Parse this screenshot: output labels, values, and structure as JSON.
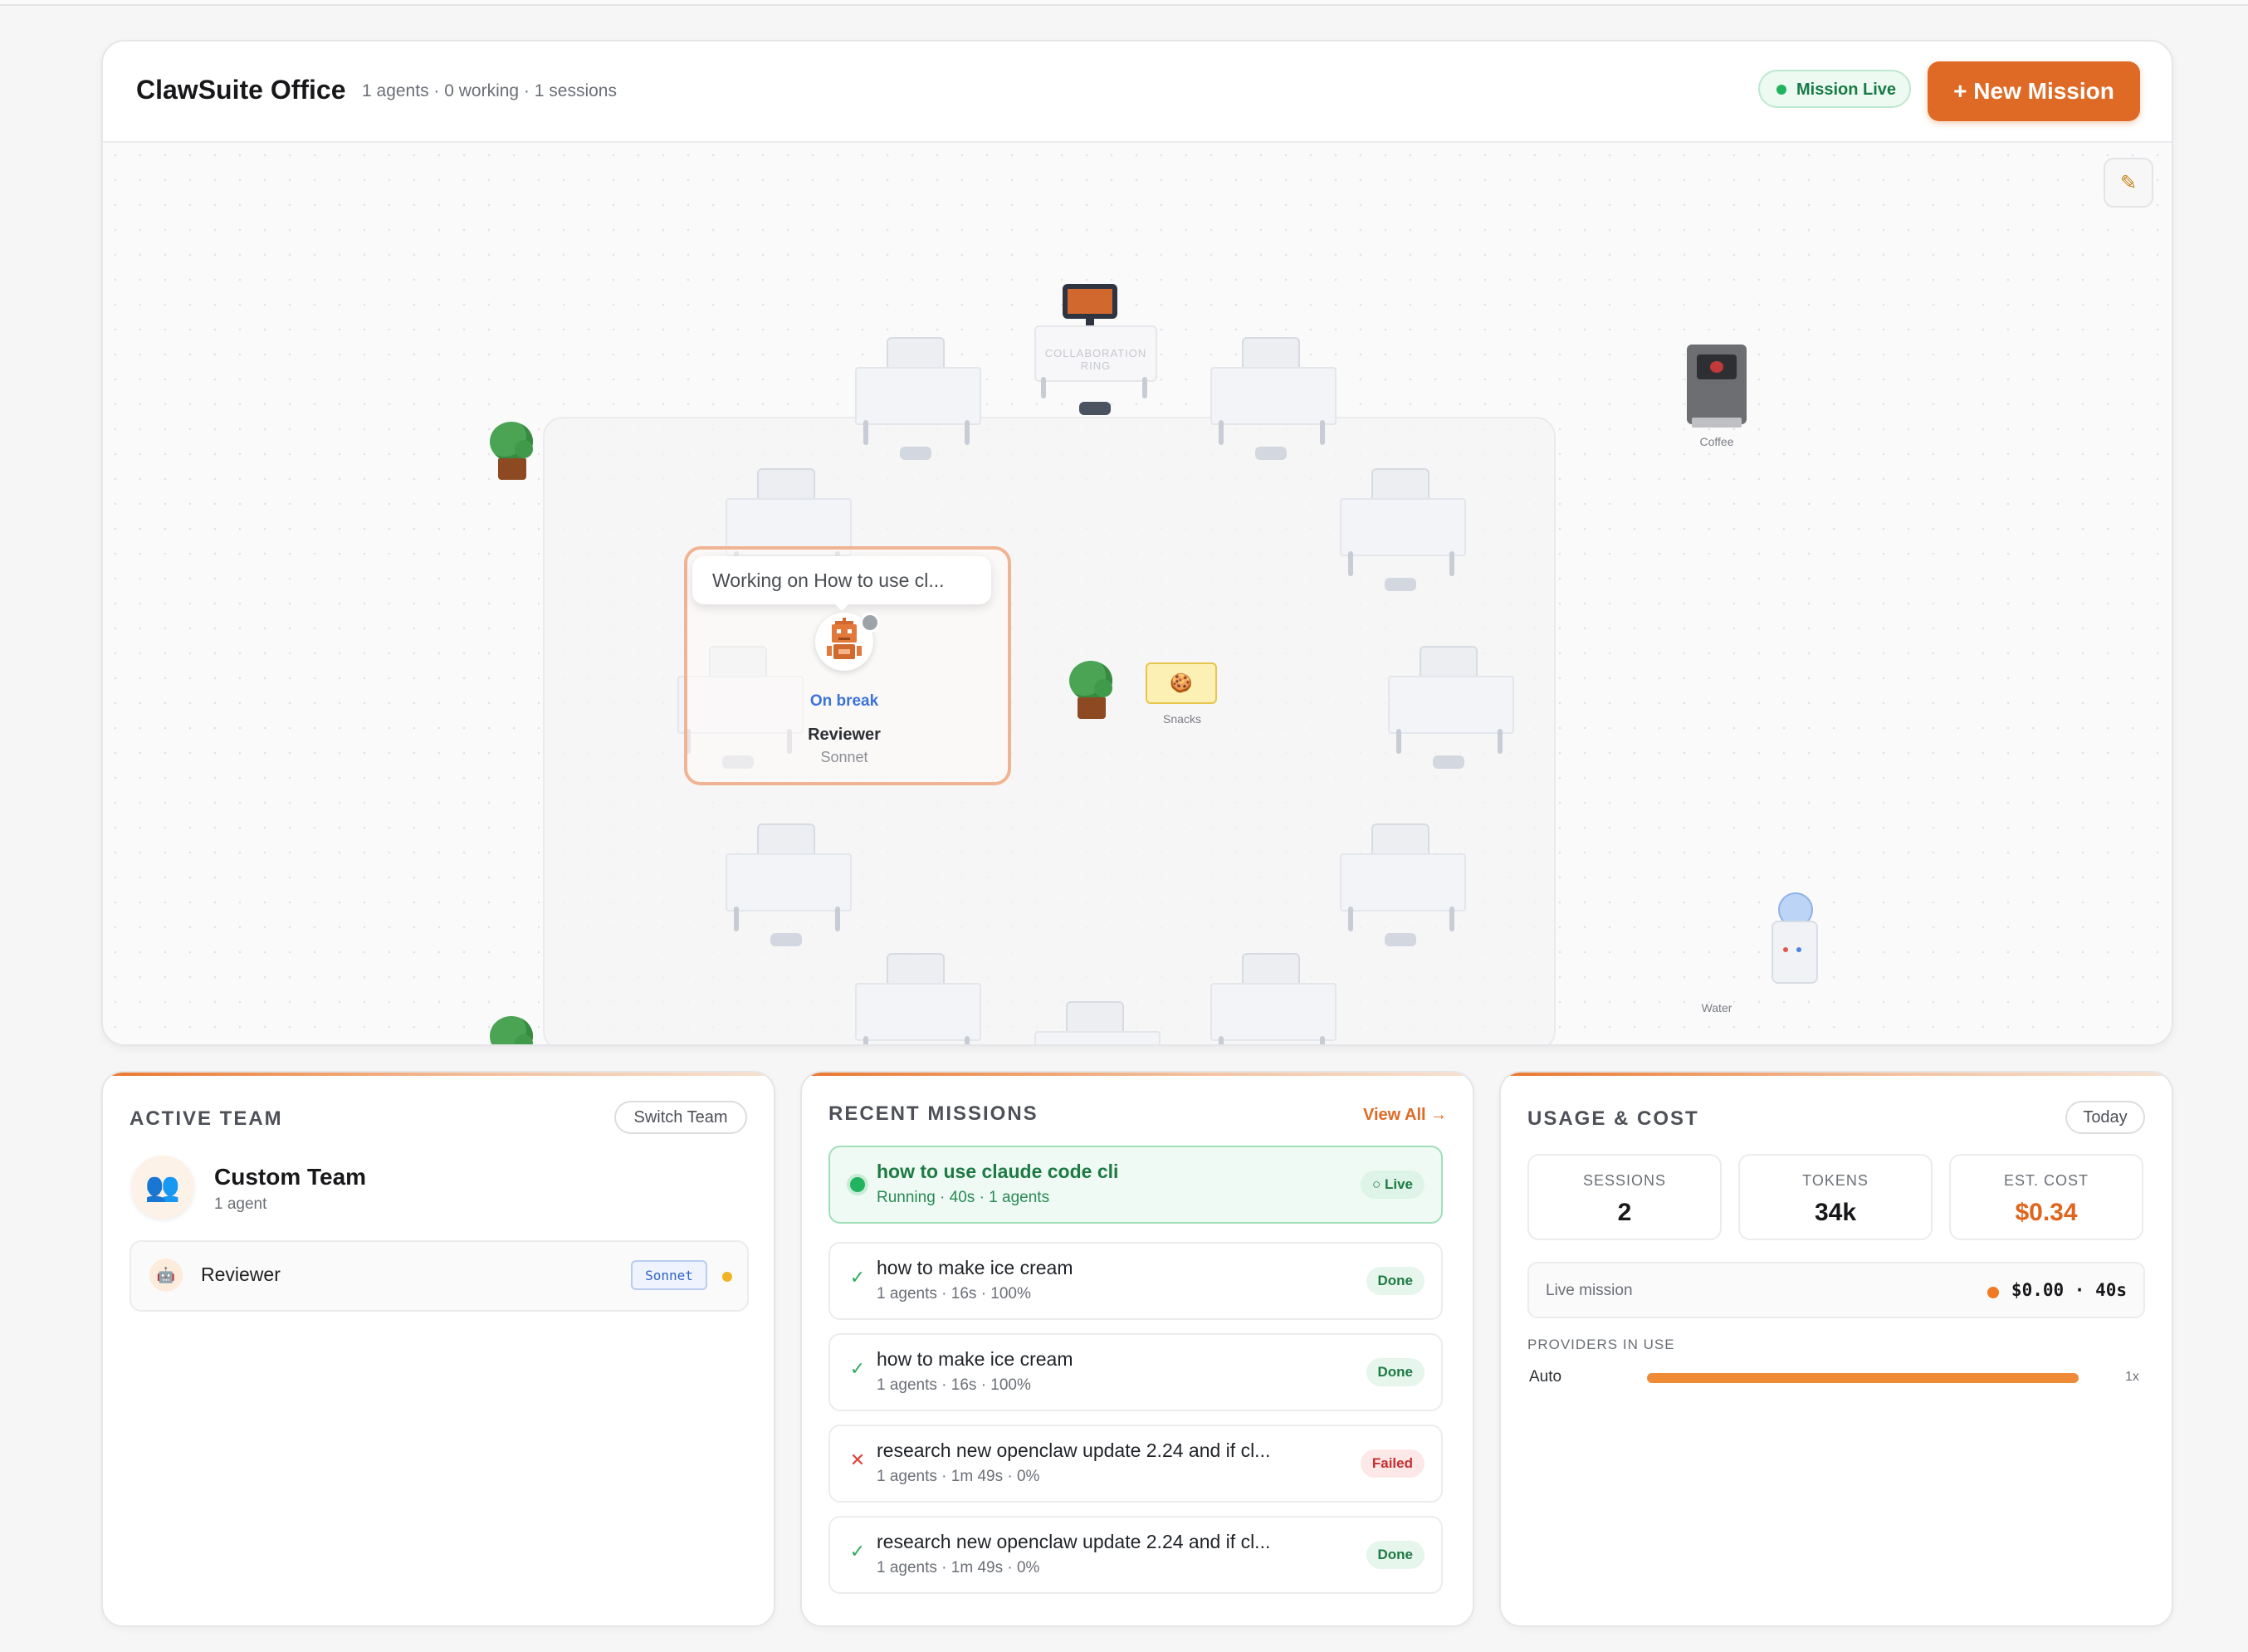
{
  "header": {
    "title": "ClawSuite Office",
    "summary": "1 agents · 0 working · 1 sessions",
    "mission_live": "Mission Live",
    "new_mission": "+ New Mission"
  },
  "office": {
    "edit_icon": "✎",
    "collab_label": "COLLABORATION RING",
    "coffee_label": "Coffee",
    "snacks_label": "Snacks",
    "snacks_icon": "🍪",
    "water_label": "Water",
    "agent": {
      "bubble": "Working on How to use cl...",
      "status": "On break",
      "name": "Reviewer",
      "model": "Sonnet"
    }
  },
  "active_team": {
    "title": "ACTIVE TEAM",
    "switch": "Switch Team",
    "team_icon": "👥",
    "name": "Custom Team",
    "count": "1 agent",
    "members": [
      {
        "icon": "🤖",
        "name": "Reviewer",
        "model": "Sonnet"
      }
    ]
  },
  "recent_missions": {
    "title": "RECENT MISSIONS",
    "view_all": "View All →",
    "items": [
      {
        "title": "how to use claude code cli",
        "sub": "Running · 40s · 1 agents",
        "tag": "○ Live",
        "state": "live"
      },
      {
        "title": "how to make ice cream",
        "sub": "1 agents · 16s · 100%",
        "tag": "Done",
        "state": "done"
      },
      {
        "title": "how to make ice cream",
        "sub": "1 agents · 16s · 100%",
        "tag": "Done",
        "state": "done"
      },
      {
        "title": "research new openclaw update 2.24 and if cl...",
        "sub": "1 agents · 1m 49s · 0%",
        "tag": "Failed",
        "state": "failed"
      },
      {
        "title": "research new openclaw update 2.24 and if cl...",
        "sub": "1 agents · 1m 49s · 0%",
        "tag": "Done",
        "state": "done"
      }
    ]
  },
  "usage": {
    "title": "USAGE & COST",
    "range": "Today",
    "stats": [
      {
        "label": "SESSIONS",
        "value": "2"
      },
      {
        "label": "TOKENS",
        "value": "34k"
      },
      {
        "label": "EST. COST",
        "value": "$0.34"
      }
    ],
    "live_label": "Live mission",
    "live_value": "$0.00 · 40s",
    "providers_title": "PROVIDERS IN USE",
    "providers": [
      {
        "name": "Auto",
        "share": 1.0,
        "multiplier": "1x"
      }
    ]
  },
  "colors": {
    "accent": "#de6a25",
    "live_green": "#22b35e",
    "failed_red": "#e0413a",
    "on_break_blue": "#3b73d9"
  }
}
